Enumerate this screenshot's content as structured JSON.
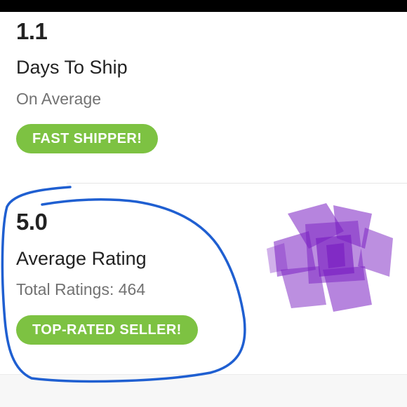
{
  "shipping": {
    "value": "1.1",
    "title": "Days To Ship",
    "subtitle": "On Average",
    "badge": "FAST SHIPPER!"
  },
  "rating": {
    "value": "5.0",
    "title": "Average Rating",
    "subtitle": "Total Ratings: 464",
    "badge": "TOP-RATED SELLER!"
  },
  "colors": {
    "badge_green": "#7dc242",
    "annotation_blue": "#1f5fd1",
    "blob_purple": "#7a1fc2"
  }
}
